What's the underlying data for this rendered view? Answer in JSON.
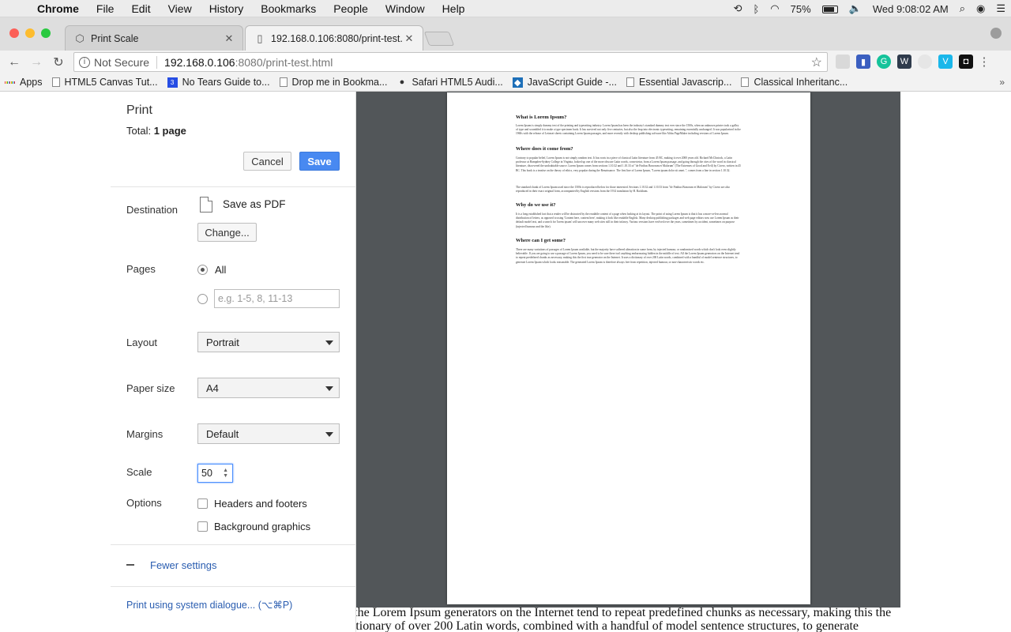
{
  "menubar": {
    "app": "Chrome",
    "items": [
      "File",
      "Edit",
      "View",
      "History",
      "Bookmarks",
      "People",
      "Window",
      "Help"
    ],
    "battery": "75%",
    "clock": "Wed 9:08:02 AM"
  },
  "tabs": [
    {
      "title": "Print Scale"
    },
    {
      "title": "192.168.0.106:8080/print-test."
    }
  ],
  "omnibox": {
    "security": "Not Secure",
    "host": "192.168.0.106",
    "path": ":8080/print-test.html"
  },
  "bookmarks": {
    "apps": "Apps",
    "items": [
      "HTML5 Canvas Tut...",
      "No Tears Guide to...",
      "Drop me in Bookma...",
      "Safari HTML5 Audi...",
      "JavaScript Guide -...",
      "Essential Javascrip...",
      "Classical Inheritanc..."
    ]
  },
  "print": {
    "heading": "Print",
    "total_label": "Total:",
    "total_value": "1 page",
    "cancel": "Cancel",
    "save": "Save",
    "destination_label": "Destination",
    "destination_value": "Save as PDF",
    "change": "Change...",
    "pages_label": "Pages",
    "pages_all": "All",
    "pages_placeholder": "e.g. 1-5, 8, 11-13",
    "layout_label": "Layout",
    "layout_value": "Portrait",
    "paper_label": "Paper size",
    "paper_value": "A4",
    "margins_label": "Margins",
    "margins_value": "Default",
    "scale_label": "Scale",
    "scale_value": "50",
    "options_label": "Options",
    "opt_headers": "Headers and footers",
    "opt_background": "Background graphics",
    "fewer": "Fewer settings",
    "system": "Print using system dialogue... (⌥⌘P)"
  },
  "preview": {
    "h1": "What is Lorem Ipsum?",
    "p1": "Lorem Ipsum is simply dummy text of the printing and typesetting industry. Lorem Ipsum has been the industry's standard dummy text ever since the 1500s, when an unknown printer took a galley of type and scrambled it to make a type specimen book. It has survived not only five centuries, but also the leap into electronic typesetting, remaining essentially unchanged. It was popularised in the 1960s with the release of Letraset sheets containing Lorem Ipsum passages, and more recently with desktop publishing software like Aldus PageMaker including versions of Lorem Ipsum.",
    "h2": "Where does it come from?",
    "p2": "Contrary to popular belief, Lorem Ipsum is not simply random text. It has roots in a piece of classical Latin literature from 45 BC, making it over 2000 years old. Richard McClintock, a Latin professor at Hampden-Sydney College in Virginia, looked up one of the more obscure Latin words, consectetur, from a Lorem Ipsum passage, and going through the cites of the word in classical literature, discovered the undoubtable source. Lorem Ipsum comes from sections 1.10.32 and 1.10.33 of \"de Finibus Bonorum et Malorum\" (The Extremes of Good and Evil) by Cicero, written in 45 BC. This book is a treatise on the theory of ethics, very popular during the Renaissance. The first line of Lorem Ipsum, \"Lorem ipsum dolor sit amet..\", comes from a line in section 1.10.32.",
    "p2b": "The standard chunk of Lorem Ipsum used since the 1500s is reproduced below for those interested. Sections 1.10.32 and 1.10.33 from \"de Finibus Bonorum et Malorum\" by Cicero are also reproduced in their exact original form, accompanied by English versions from the 1914 translation by H. Rackham.",
    "h3": "Why do we use it?",
    "p3": "It is a long established fact that a reader will be distracted by the readable content of a page when looking at its layout. The point of using Lorem Ipsum is that it has a more-or-less normal distribution of letters, as opposed to using 'Content here, content here', making it look like readable English. Many desktop publishing packages and web page editors now use Lorem Ipsum as their default model text, and a search for 'lorem ipsum' will uncover many web sites still in their infancy. Various versions have evolved over the years, sometimes by accident, sometimes on purpose (injected humour and the like).",
    "h4": "Where can I get some?",
    "p4": "There are many variations of passages of Lorem Ipsum available, but the majority have suffered alteration in some form, by injected humour, or randomised words which don't look even slightly believable. If you are going to use a passage of Lorem Ipsum, you need to be sure there isn't anything embarrassing hidden in the middle of text. All the Lorem Ipsum generators on the Internet tend to repeat predefined chunks as necessary, making this the first true generator on the Internet. It uses a dictionary of over 200 Latin words, combined with a handful of model sentence structures, to generate Lorem Ipsum which looks reasonable. The generated Lorem Ipsum is therefore always free from repetition, injected humour, or non-characteristic words etc."
  },
  "background_text": "embarrassing hidden in the middle of text. All the Lorem Ipsum generators on the Internet tend to repeat predefined chunks as necessary, making this the first true generator on the Internet. It uses a dictionary of over 200 Latin words, combined with a handful of model sentence structures, to generate"
}
